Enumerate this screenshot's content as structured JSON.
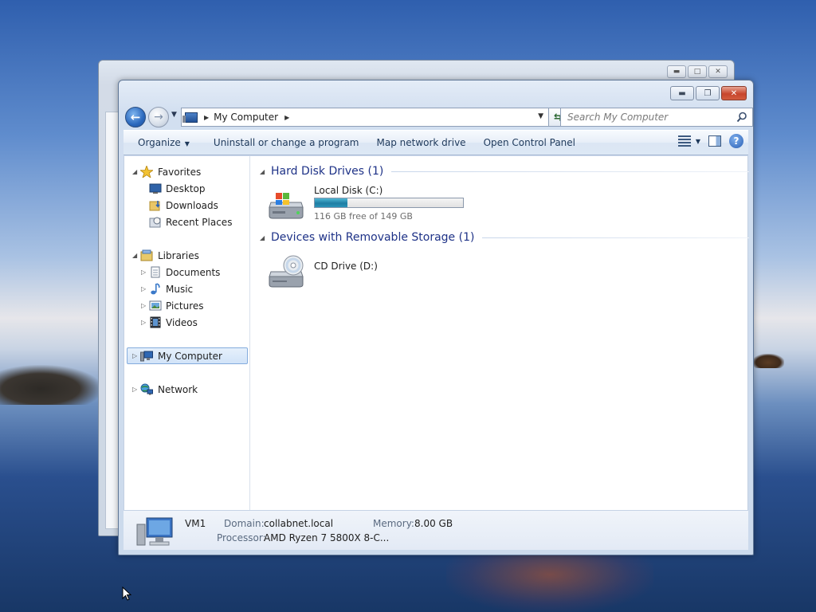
{
  "explorer": {
    "address": {
      "location": "My Computer"
    },
    "search": {
      "placeholder": "Search My Computer"
    },
    "toolbar": {
      "organize": "Organize",
      "uninstall": "Uninstall or change a program",
      "map_drive": "Map network drive",
      "control_panel": "Open Control Panel"
    },
    "nav": {
      "favorites": "Favorites",
      "desktop": "Desktop",
      "downloads": "Downloads",
      "recent": "Recent Places",
      "libraries": "Libraries",
      "documents": "Documents",
      "music": "Music",
      "pictures": "Pictures",
      "videos": "Videos",
      "computer": "My Computer",
      "network": "Network"
    },
    "groups": {
      "hdd": {
        "title": "Hard Disk Drives (1)",
        "drive_name": "Local Disk (C:)",
        "free_text": "116 GB free of 149 GB",
        "used_fraction": 0.22
      },
      "removable": {
        "title": "Devices with Removable Storage (1)",
        "drive_name": "CD Drive (D:)"
      }
    },
    "details": {
      "name": "VM1",
      "domain_label": "Domain:",
      "domain_value": "collabnet.local",
      "memory_label": "Memory:",
      "memory_value": "8.00 GB",
      "processor_label": "Processor:",
      "processor_value": "AMD Ryzen 7 5800X 8-C..."
    }
  }
}
